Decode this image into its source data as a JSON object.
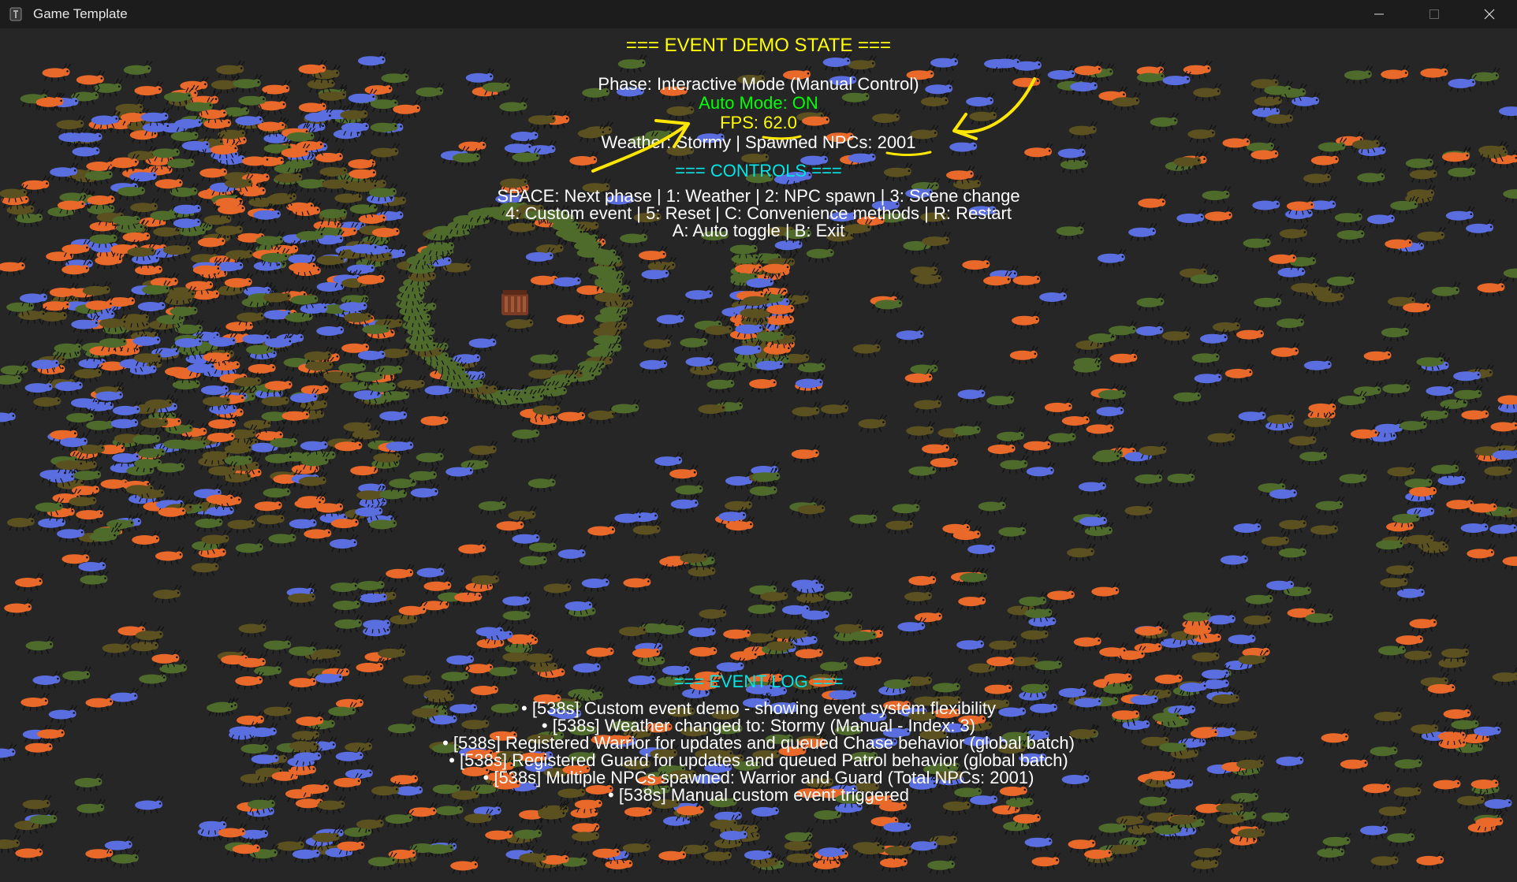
{
  "window": {
    "title": "Game Template",
    "minimize_icon": "minimize-icon",
    "maximize_icon": "maximize-icon",
    "close_icon": "close-icon"
  },
  "state": {
    "heading": "=== EVENT DEMO STATE ===",
    "phase": "Phase: Interactive Mode (Manual Control)",
    "auto_mode": "Auto Mode: ON",
    "fps": "FPS: 62.0",
    "weather_npcs": "Weather: Stormy | Spawned NPCs: 2001"
  },
  "controls": {
    "heading": "=== CONTROLS ===",
    "lines": [
      "SPACE: Next phase | 1: Weather | 2: NPC spawn | 3: Scene change",
      "4: Custom event | 5: Reset | C: Convenience methods | R: Restart",
      "A: Auto toggle | B: Exit"
    ]
  },
  "log": {
    "heading": "=== EVENT LOG ===",
    "entries": [
      "• [538s] Custom event demo - showing event system flexibility",
      "• [538s] Weather changed to: Stormy (Manual - Index: 3)",
      "• [538s] Registered Warrior for updates and queued Chase behavior (global batch)",
      "• [538s] Registered Guard for updates and queued Patrol behavior (global batch)",
      "• [538s] Multiple NPCs spawned: Warrior and Guard (Total NPCs: 2001)",
      "• [538s] Manual custom event triggered"
    ]
  },
  "colors": {
    "state_heading": "#ffff00",
    "phase": "#ffffff",
    "auto_mode": "#00ff00",
    "fps": "#ffff00",
    "controls_heading": "#00e5e5",
    "log_heading": "#00e5e5",
    "npc_orange": "#e8692a",
    "npc_blue": "#5a6ee0",
    "npc_green": "#4f6b2c",
    "npc_olive": "#5a5020",
    "annotation": "#ffe600"
  }
}
